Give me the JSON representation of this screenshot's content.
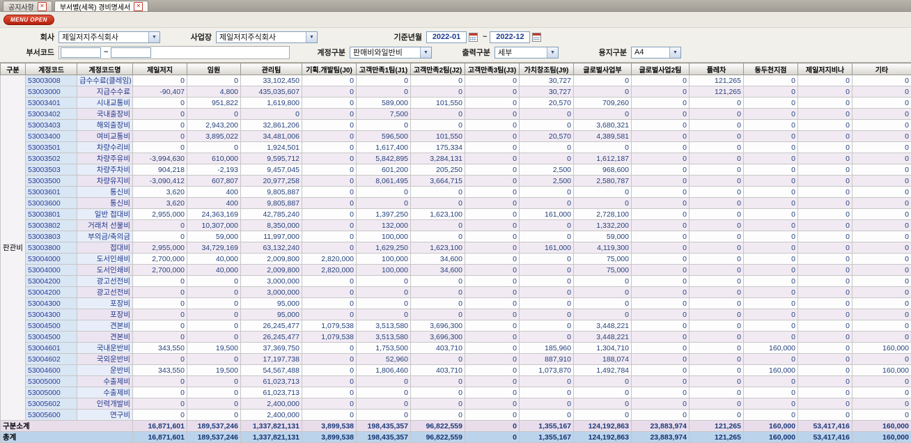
{
  "tabs": [
    {
      "label": "공지사항"
    },
    {
      "label": "부서별(세목) 경비명세서"
    }
  ],
  "menu_open_label": "MENU OPEN",
  "filters": {
    "company_label": "회사",
    "company_value": "제일저지주식회사",
    "worksite_label": "사업장",
    "worksite_value": "제일저지주식회사",
    "period_label": "기준년월",
    "period_from": "2022-01",
    "period_to": "2022-12",
    "tilde": "~",
    "dept_code_label": "부서코드",
    "dept_from": "",
    "dept_to": "",
    "account_group_label": "계정구분",
    "account_group_value": "판매비와일반비",
    "output_label": "출력구분",
    "output_value": "세부",
    "paper_label": "용지구분",
    "paper_value": "A4"
  },
  "table": {
    "columns": [
      "구분",
      "계정코드",
      "계정코드명",
      "제일저지",
      "임원",
      "관리팀",
      "기획.개발팀(J0)",
      "고객만족1팀(J1)",
      "고객만족2팀(J2)",
      "고객만족3팀(J3)",
      "가치창조팀(J9)",
      "글로벌사업부",
      "글로벌사업2팀",
      "플레차",
      "동두천지점",
      "제일저지비나",
      "기타"
    ],
    "group_label": "판관비",
    "rows": [
      {
        "code": "53003008",
        "name": "급수수료(클레임)",
        "values": [
          "0",
          "0",
          "33,102,450",
          "0",
          "0",
          "0",
          "0",
          "30,727",
          "0",
          "0",
          "121,265",
          "0",
          "0",
          "0"
        ]
      },
      {
        "code": "53003000",
        "name": "지급수수료",
        "values": [
          "-90,407",
          "4,800",
          "435,035,607",
          "0",
          "0",
          "0",
          "0",
          "30,727",
          "0",
          "0",
          "121,265",
          "0",
          "0",
          "0"
        ]
      },
      {
        "code": "53003401",
        "name": "시내교통비",
        "values": [
          "0",
          "951,822",
          "1,619,800",
          "0",
          "589,000",
          "101,550",
          "0",
          "20,570",
          "709,260",
          "0",
          "0",
          "0",
          "0",
          "0"
        ]
      },
      {
        "code": "53003402",
        "name": "국내출장비",
        "values": [
          "0",
          "0",
          "0",
          "0",
          "7,500",
          "0",
          "0",
          "0",
          "0",
          "0",
          "0",
          "0",
          "0",
          "0"
        ]
      },
      {
        "code": "53003403",
        "name": "해외출장비",
        "values": [
          "0",
          "2,943,200",
          "32,861,206",
          "0",
          "0",
          "0",
          "0",
          "0",
          "3,680,321",
          "0",
          "0",
          "0",
          "0",
          "0"
        ]
      },
      {
        "code": "53003400",
        "name": "여비교통비",
        "values": [
          "0",
          "3,895,022",
          "34,481,006",
          "0",
          "596,500",
          "101,550",
          "0",
          "20,570",
          "4,389,581",
          "0",
          "0",
          "0",
          "0",
          "0"
        ]
      },
      {
        "code": "53003501",
        "name": "차량수리비",
        "values": [
          "0",
          "0",
          "1,924,501",
          "0",
          "1,617,400",
          "175,334",
          "0",
          "0",
          "0",
          "0",
          "0",
          "0",
          "0",
          "0"
        ]
      },
      {
        "code": "53003502",
        "name": "차량주유비",
        "values": [
          "-3,994,630",
          "610,000",
          "9,595,712",
          "0",
          "5,842,895",
          "3,284,131",
          "0",
          "0",
          "1,612,187",
          "0",
          "0",
          "0",
          "0",
          "0"
        ]
      },
      {
        "code": "53003503",
        "name": "차량주차비",
        "values": [
          "904,218",
          "-2,193",
          "9,457,045",
          "0",
          "601,200",
          "205,250",
          "0",
          "2,500",
          "968,600",
          "0",
          "0",
          "0",
          "0",
          "0"
        ]
      },
      {
        "code": "53003500",
        "name": "차량유지비",
        "values": [
          "-3,090,412",
          "607,807",
          "20,977,258",
          "0",
          "8,061,495",
          "3,664,715",
          "0",
          "2,500",
          "2,580,787",
          "0",
          "0",
          "0",
          "0",
          "0"
        ]
      },
      {
        "code": "53003601",
        "name": "통신비",
        "values": [
          "3,620",
          "400",
          "9,805,887",
          "0",
          "0",
          "0",
          "0",
          "0",
          "0",
          "0",
          "0",
          "0",
          "0",
          "0"
        ]
      },
      {
        "code": "53003600",
        "name": "통신비",
        "values": [
          "3,620",
          "400",
          "9,805,887",
          "0",
          "0",
          "0",
          "0",
          "0",
          "0",
          "0",
          "0",
          "0",
          "0",
          "0"
        ]
      },
      {
        "code": "53003801",
        "name": "일반 접대비",
        "values": [
          "2,955,000",
          "24,363,169",
          "42,785,240",
          "0",
          "1,397,250",
          "1,623,100",
          "0",
          "161,000",
          "2,728,100",
          "0",
          "0",
          "0",
          "0",
          "0"
        ]
      },
      {
        "code": "53003802",
        "name": "거래처 선물비",
        "values": [
          "0",
          "10,307,000",
          "8,350,000",
          "0",
          "132,000",
          "0",
          "0",
          "0",
          "1,332,200",
          "0",
          "0",
          "0",
          "0",
          "0"
        ]
      },
      {
        "code": "53003803",
        "name": "부의금/축의금",
        "values": [
          "0",
          "59,000",
          "11,997,000",
          "0",
          "100,000",
          "0",
          "0",
          "0",
          "59,000",
          "0",
          "0",
          "0",
          "0",
          "0"
        ]
      },
      {
        "code": "53003800",
        "name": "접대비",
        "values": [
          "2,955,000",
          "34,729,169",
          "63,132,240",
          "0",
          "1,629,250",
          "1,623,100",
          "0",
          "161,000",
          "4,119,300",
          "0",
          "0",
          "0",
          "0",
          "0"
        ]
      },
      {
        "code": "53004000",
        "name": "도서인쇄비",
        "values": [
          "2,700,000",
          "40,000",
          "2,009,800",
          "2,820,000",
          "100,000",
          "34,600",
          "0",
          "0",
          "75,000",
          "0",
          "0",
          "0",
          "0",
          "0"
        ]
      },
      {
        "code": "53004000",
        "name": "도서인쇄비",
        "values": [
          "2,700,000",
          "40,000",
          "2,009,800",
          "2,820,000",
          "100,000",
          "34,600",
          "0",
          "0",
          "75,000",
          "0",
          "0",
          "0",
          "0",
          "0"
        ]
      },
      {
        "code": "53004200",
        "name": "광고선전비",
        "values": [
          "0",
          "0",
          "3,000,000",
          "0",
          "0",
          "0",
          "0",
          "0",
          "0",
          "0",
          "0",
          "0",
          "0",
          "0"
        ]
      },
      {
        "code": "53004200",
        "name": "광고선전비",
        "values": [
          "0",
          "0",
          "3,000,000",
          "0",
          "0",
          "0",
          "0",
          "0",
          "0",
          "0",
          "0",
          "0",
          "0",
          "0"
        ]
      },
      {
        "code": "53004300",
        "name": "포장비",
        "values": [
          "0",
          "0",
          "95,000",
          "0",
          "0",
          "0",
          "0",
          "0",
          "0",
          "0",
          "0",
          "0",
          "0",
          "0"
        ]
      },
      {
        "code": "53004300",
        "name": "포장비",
        "values": [
          "0",
          "0",
          "95,000",
          "0",
          "0",
          "0",
          "0",
          "0",
          "0",
          "0",
          "0",
          "0",
          "0",
          "0"
        ]
      },
      {
        "code": "53004500",
        "name": "견본비",
        "values": [
          "0",
          "0",
          "26,245,477",
          "1,079,538",
          "3,513,580",
          "3,696,300",
          "0",
          "0",
          "3,448,221",
          "0",
          "0",
          "0",
          "0",
          "0"
        ]
      },
      {
        "code": "53004500",
        "name": "견본비",
        "values": [
          "0",
          "0",
          "26,245,477",
          "1,079,538",
          "3,513,580",
          "3,696,300",
          "0",
          "0",
          "3,448,221",
          "0",
          "0",
          "0",
          "0",
          "0"
        ]
      },
      {
        "code": "53004601",
        "name": "국내운반비",
        "values": [
          "343,550",
          "19,500",
          "37,369,750",
          "0",
          "1,753,500",
          "403,710",
          "0",
          "185,960",
          "1,304,710",
          "0",
          "0",
          "160,000",
          "0",
          "160,000"
        ]
      },
      {
        "code": "53004602",
        "name": "국외운반비",
        "values": [
          "0",
          "0",
          "17,197,738",
          "0",
          "52,960",
          "0",
          "0",
          "887,910",
          "188,074",
          "0",
          "0",
          "0",
          "0",
          "0"
        ]
      },
      {
        "code": "53004600",
        "name": "운반비",
        "values": [
          "343,550",
          "19,500",
          "54,567,488",
          "0",
          "1,806,460",
          "403,710",
          "0",
          "1,073,870",
          "1,492,784",
          "0",
          "0",
          "160,000",
          "0",
          "160,000"
        ]
      },
      {
        "code": "53005000",
        "name": "수출제비",
        "values": [
          "0",
          "0",
          "61,023,713",
          "0",
          "0",
          "0",
          "0",
          "0",
          "0",
          "0",
          "0",
          "0",
          "0",
          "0"
        ]
      },
      {
        "code": "53005000",
        "name": "수출제비",
        "values": [
          "0",
          "0",
          "61,023,713",
          "0",
          "0",
          "0",
          "0",
          "0",
          "0",
          "0",
          "0",
          "0",
          "0",
          "0"
        ]
      },
      {
        "code": "53005602",
        "name": "인력개발비",
        "values": [
          "0",
          "0",
          "2,400,000",
          "0",
          "0",
          "0",
          "0",
          "0",
          "0",
          "0",
          "0",
          "0",
          "0",
          "0"
        ]
      },
      {
        "code": "53005600",
        "name": "연구비",
        "values": [
          "0",
          "0",
          "2,400,000",
          "0",
          "0",
          "0",
          "0",
          "0",
          "0",
          "0",
          "0",
          "0",
          "0",
          "0"
        ]
      }
    ],
    "subtotal": {
      "label": "구분소계",
      "values": [
        "16,871,601",
        "189,537,246",
        "1,337,821,131",
        "3,899,538",
        "198,435,357",
        "96,822,559",
        "0",
        "1,355,167",
        "124,192,863",
        "23,883,974",
        "121,265",
        "160,000",
        "53,417,416",
        "160,000"
      ]
    },
    "total": {
      "label": "총계",
      "values": [
        "16,871,601",
        "189,537,246",
        "1,337,821,131",
        "3,899,538",
        "198,435,357",
        "96,822,559",
        "0",
        "1,355,167",
        "124,192,863",
        "23,883,974",
        "121,265",
        "160,000",
        "53,417,416",
        "160,000"
      ]
    }
  }
}
